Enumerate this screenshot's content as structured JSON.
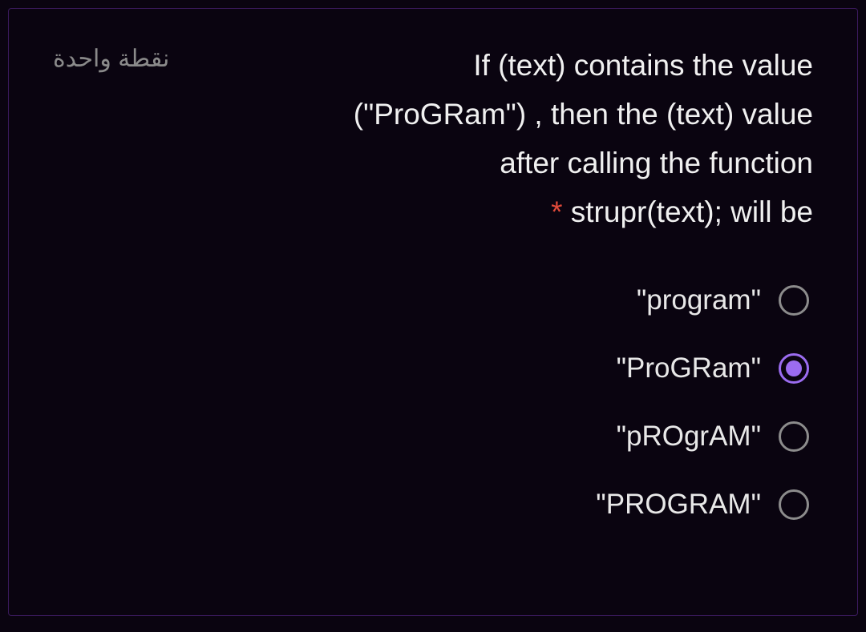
{
  "points_label": "نقطة واحدة",
  "question": {
    "line1": "If (text) contains the value",
    "line2": "(\"ProGRam\") , then the (text) value",
    "line3": "after calling the function",
    "line4_prefix": "strupr(text); will be",
    "asterisk": "*"
  },
  "options": [
    {
      "label": "\"program\"",
      "selected": false
    },
    {
      "label": "\"ProGRam\"",
      "selected": true
    },
    {
      "label": "\"pROgrAM\"",
      "selected": false
    },
    {
      "label": "\"PROGRAM\"",
      "selected": false
    }
  ]
}
